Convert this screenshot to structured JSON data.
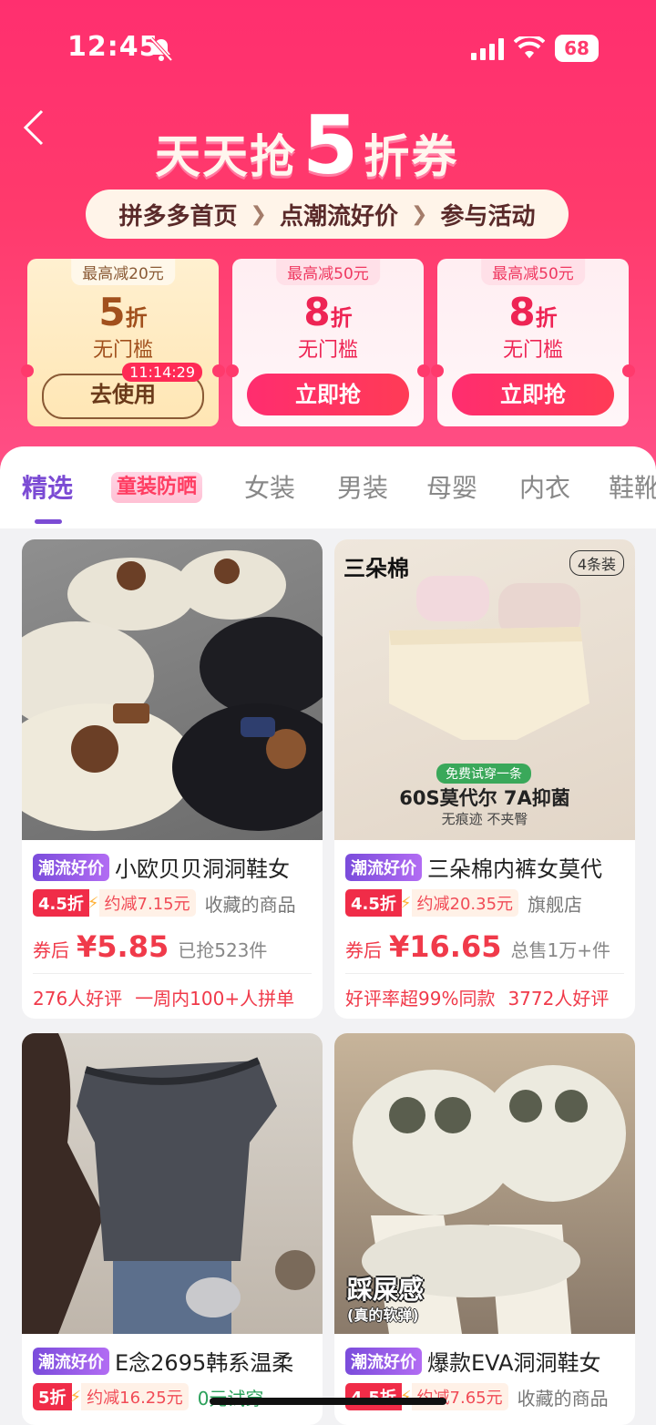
{
  "status": {
    "time": "12:45",
    "battery": "68"
  },
  "header": {
    "title_a": "天天抢",
    "title_b": "5",
    "title_c": "折券",
    "steps": [
      "拼多多首页",
      "点潮流好价",
      "参与活动"
    ]
  },
  "coupons": [
    {
      "cap": "最高减20元",
      "num": "5",
      "unit": "折",
      "sub": "无门槛",
      "button": "去使用",
      "timer": "11:14:29"
    },
    {
      "cap": "最高减50元",
      "num": "8",
      "unit": "折",
      "sub": "无门槛",
      "button": "立即抢"
    },
    {
      "cap": "最高减50元",
      "num": "8",
      "unit": "折",
      "sub": "无门槛",
      "button": "立即抢"
    }
  ],
  "tabs": [
    "精选",
    "童装防晒",
    "女装",
    "男装",
    "母婴",
    "内衣",
    "鞋靴"
  ],
  "products": [
    {
      "tag": "潮流好价",
      "title": "小欧贝贝洞洞鞋女",
      "discount": "4.5折",
      "save": "约减7.15元",
      "meta": "收藏的商品",
      "after": "券后",
      "price": "¥5.85",
      "sold": "已抢523件",
      "extra": [
        "276人好评",
        "一周内100+人拼单"
      ]
    },
    {
      "tag": "潮流好价",
      "title": "三朵棉内裤女莫代",
      "discount": "4.5折",
      "save": "约减20.35元",
      "meta": "旗舰店",
      "after": "券后",
      "price": "¥16.65",
      "sold": "总售1万+件",
      "extra": [
        "好评率超99%同款",
        "3772人好评"
      ],
      "img_brand": "三朵棉",
      "img_pack": "4条装",
      "img_free": "免费试穿一条",
      "img_main": "60S莫代尔 7A抑菌",
      "img_sub": "无痕迹 不夹臀"
    },
    {
      "tag": "潮流好价",
      "title": "E念2695韩系温柔",
      "discount": "5折",
      "save": "约减16.25元",
      "meta": "0元试穿"
    },
    {
      "tag": "潮流好价",
      "title": "爆款EVA洞洞鞋女",
      "discount": "4.5折",
      "save": "约减7.65元",
      "meta": "收藏的商品",
      "img_text1": "踩屎感",
      "img_text2": "(真的软弹)"
    }
  ]
}
